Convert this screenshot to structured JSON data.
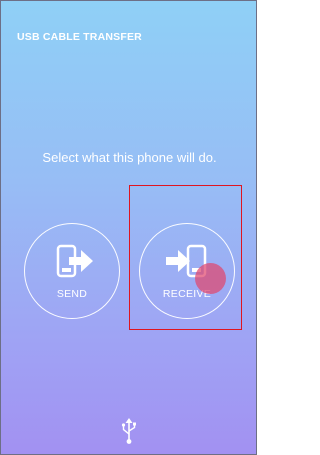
{
  "header": {
    "title": "USB CABLE TRANSFER"
  },
  "prompt": "Select what this phone will do.",
  "options": [
    {
      "label": "SEND",
      "icon": "phone-send-icon"
    },
    {
      "label": "RECEIVE",
      "icon": "phone-receive-icon"
    }
  ],
  "footer": {
    "icon": "usb-icon"
  },
  "colors": {
    "background_top": "#8fd0f6",
    "background_bottom": "#a291f2",
    "highlight": "#e0151f",
    "touch_indicator": "#e1466e"
  }
}
